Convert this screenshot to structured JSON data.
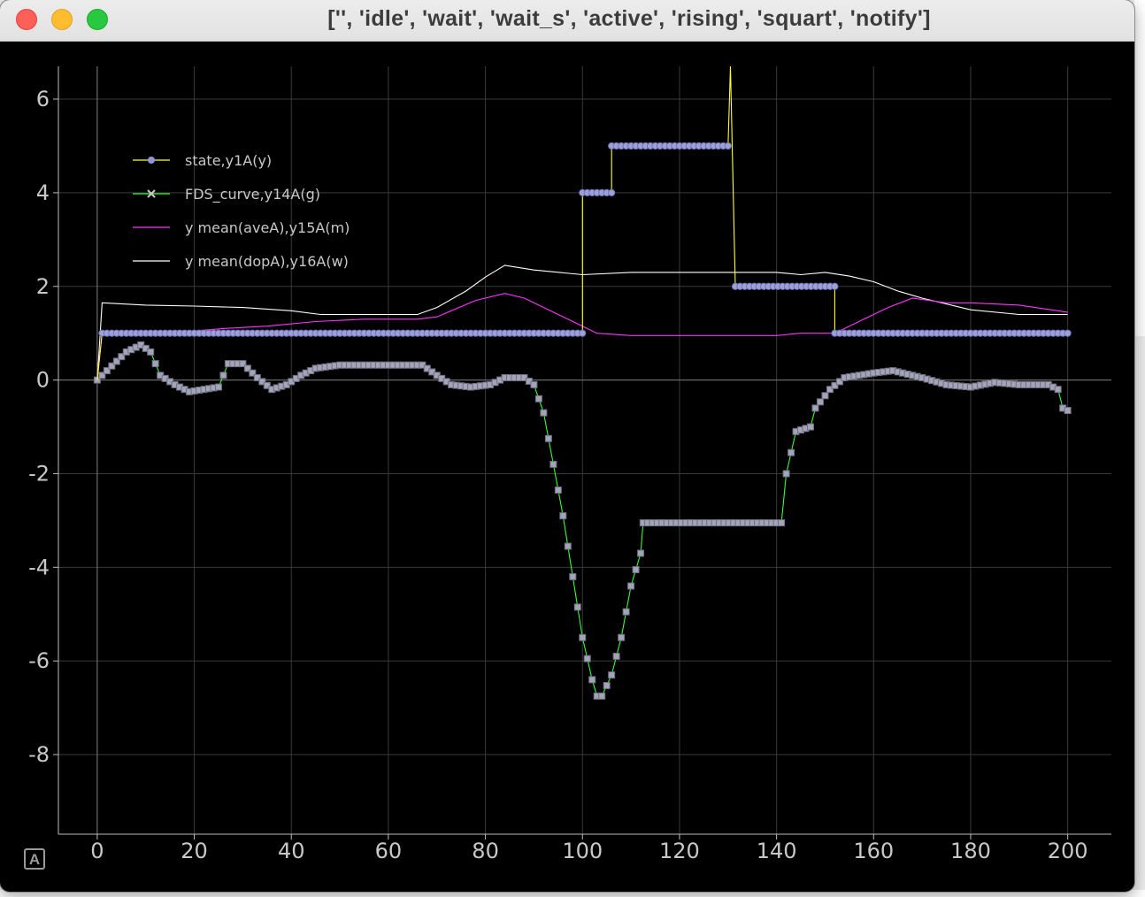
{
  "window": {
    "title": "['', 'idle', 'wait', 'wait_s', 'active', 'rising', 'squart', 'notify']"
  },
  "autoscale_button": {
    "label": "A"
  },
  "colors": {
    "background": "#000000",
    "grid": "#3a3a3a",
    "axis": "#bdbdbd",
    "state": "#ffff33",
    "state_marker": "#9ea1d8",
    "fds": "#33ff33",
    "fds_marker": "#a4a4b8",
    "ave": "#ff33ff",
    "dop": "#ffffff"
  },
  "chart_data": {
    "type": "line",
    "xlim": [
      -8,
      209
    ],
    "ylim": [
      -9.7,
      6.7
    ],
    "x_ticks": [
      0,
      20,
      40,
      60,
      80,
      100,
      120,
      140,
      160,
      180,
      200
    ],
    "y_ticks": [
      6,
      4,
      2,
      0,
      -2,
      -4,
      -6,
      -8
    ],
    "grid": true,
    "legend_position": "top-left",
    "legend": [
      {
        "label": "state,y1A(y)",
        "key": "state"
      },
      {
        "label": "FDS_curve,y14A(g)",
        "key": "fds"
      },
      {
        "label": "y mean(aveA),y15A(m)",
        "key": "ave"
      },
      {
        "label": "y mean(dopA),y16A(w)",
        "key": "dop"
      }
    ],
    "series": [
      {
        "name": "state,y1A(y)",
        "key": "state",
        "marker": "circle",
        "points": [
          [
            0,
            0
          ],
          [
            1,
            1
          ],
          [
            100,
            1
          ],
          [
            100,
            4
          ],
          [
            106,
            4
          ],
          [
            106,
            5
          ],
          [
            130,
            5
          ],
          [
            130.5,
            6.7
          ],
          [
            131.5,
            2
          ],
          [
            152,
            2
          ],
          [
            152,
            1
          ],
          [
            200,
            1
          ]
        ]
      },
      {
        "name": "FDS_curve,y14A(g)",
        "key": "fds",
        "marker": "x",
        "points": [
          [
            0,
            0
          ],
          [
            3,
            0.3
          ],
          [
            6,
            0.6
          ],
          [
            9,
            0.75
          ],
          [
            11,
            0.6
          ],
          [
            13,
            0.1
          ],
          [
            16,
            -0.1
          ],
          [
            19,
            -0.25
          ],
          [
            22,
            -0.2
          ],
          [
            25,
            -0.15
          ],
          [
            27,
            0.35
          ],
          [
            30,
            0.35
          ],
          [
            33,
            0.05
          ],
          [
            36,
            -0.2
          ],
          [
            39,
            -0.1
          ],
          [
            42,
            0.1
          ],
          [
            45,
            0.25
          ],
          [
            50,
            0.32
          ],
          [
            60,
            0.32
          ],
          [
            67,
            0.32
          ],
          [
            70,
            0.1
          ],
          [
            73,
            -0.1
          ],
          [
            77,
            -0.15
          ],
          [
            81,
            -0.1
          ],
          [
            84,
            0.05
          ],
          [
            88,
            0.05
          ],
          [
            90,
            -0.1
          ],
          [
            92,
            -0.7
          ],
          [
            94,
            -1.8
          ],
          [
            96,
            -2.9
          ],
          [
            98,
            -4.2
          ],
          [
            100,
            -5.5
          ],
          [
            102,
            -6.4
          ],
          [
            103,
            -6.75
          ],
          [
            104,
            -6.75
          ],
          [
            106,
            -6.3
          ],
          [
            108,
            -5.5
          ],
          [
            110,
            -4.4
          ],
          [
            112,
            -3.7
          ],
          [
            112.5,
            -3.05
          ],
          [
            141,
            -3.05
          ],
          [
            142,
            -2
          ],
          [
            144,
            -1.1
          ],
          [
            147,
            -1
          ],
          [
            148,
            -0.6
          ],
          [
            151,
            -0.2
          ],
          [
            154,
            0.05
          ],
          [
            160,
            0.15
          ],
          [
            164,
            0.2
          ],
          [
            166,
            0.15
          ],
          [
            170,
            0.05
          ],
          [
            175,
            -0.1
          ],
          [
            180,
            -0.15
          ],
          [
            185,
            -0.05
          ],
          [
            190,
            -0.1
          ],
          [
            196,
            -0.1
          ],
          [
            198,
            -0.2
          ],
          [
            199,
            -0.6
          ],
          [
            200,
            -0.65
          ]
        ]
      },
      {
        "name": "y mean(aveA),y15A(m)",
        "key": "ave",
        "marker": "none",
        "points": [
          [
            0,
            0
          ],
          [
            1,
            1
          ],
          [
            20,
            1.05
          ],
          [
            26,
            1.1
          ],
          [
            35,
            1.15
          ],
          [
            45,
            1.25
          ],
          [
            55,
            1.3
          ],
          [
            66,
            1.3
          ],
          [
            70,
            1.35
          ],
          [
            78,
            1.7
          ],
          [
            84,
            1.85
          ],
          [
            88,
            1.75
          ],
          [
            95,
            1.4
          ],
          [
            100,
            1.15
          ],
          [
            103,
            1.0
          ],
          [
            110,
            0.95
          ],
          [
            140,
            0.95
          ],
          [
            145,
            1.0
          ],
          [
            152,
            1.0
          ],
          [
            158,
            1.3
          ],
          [
            163,
            1.55
          ],
          [
            168,
            1.75
          ],
          [
            175,
            1.65
          ],
          [
            180,
            1.65
          ],
          [
            190,
            1.6
          ],
          [
            200,
            1.45
          ]
        ]
      },
      {
        "name": "y mean(dopA),y16A(w)",
        "key": "dop",
        "marker": "none",
        "points": [
          [
            0,
            0
          ],
          [
            1,
            1.65
          ],
          [
            10,
            1.6
          ],
          [
            20,
            1.58
          ],
          [
            30,
            1.55
          ],
          [
            40,
            1.48
          ],
          [
            46,
            1.4
          ],
          [
            60,
            1.4
          ],
          [
            66,
            1.4
          ],
          [
            70,
            1.55
          ],
          [
            76,
            1.9
          ],
          [
            80,
            2.2
          ],
          [
            84,
            2.45
          ],
          [
            90,
            2.35
          ],
          [
            100,
            2.25
          ],
          [
            110,
            2.3
          ],
          [
            120,
            2.3
          ],
          [
            140,
            2.3
          ],
          [
            145,
            2.25
          ],
          [
            150,
            2.3
          ],
          [
            155,
            2.22
          ],
          [
            160,
            2.1
          ],
          [
            165,
            1.9
          ],
          [
            170,
            1.75
          ],
          [
            180,
            1.5
          ],
          [
            190,
            1.4
          ],
          [
            200,
            1.4
          ]
        ]
      }
    ]
  }
}
